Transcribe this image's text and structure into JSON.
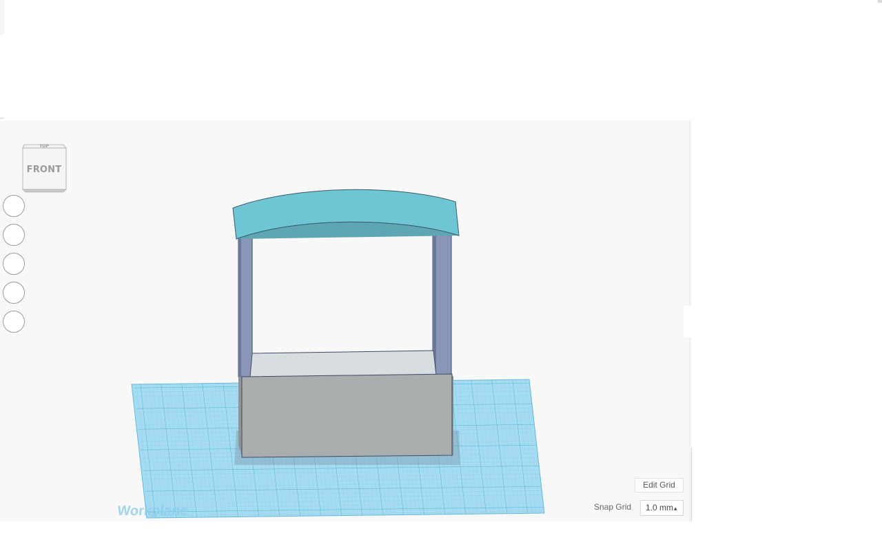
{
  "view_cube": {
    "top_label": "TOP",
    "front_label": "FRONT"
  },
  "nav_controls": [
    {
      "name": "home-view"
    },
    {
      "name": "fit-all"
    },
    {
      "name": "zoom-in"
    },
    {
      "name": "zoom-out"
    },
    {
      "name": "projection-toggle"
    }
  ],
  "workplane": {
    "label": "Workplane",
    "color": "#9ad6ee",
    "grid_color": "#5ab8dc"
  },
  "model": {
    "roof_color": "#6ec6d4",
    "pillar_color": "#8a96b8",
    "box_color": "#aaadad",
    "box_top_color": "#d6dbde"
  },
  "grid_controls": {
    "edit_grid_label": "Edit Grid",
    "snap_grid_label": "Snap Grid",
    "snap_grid_value": "1.0 mm",
    "snap_grid_arrow": "▴"
  }
}
